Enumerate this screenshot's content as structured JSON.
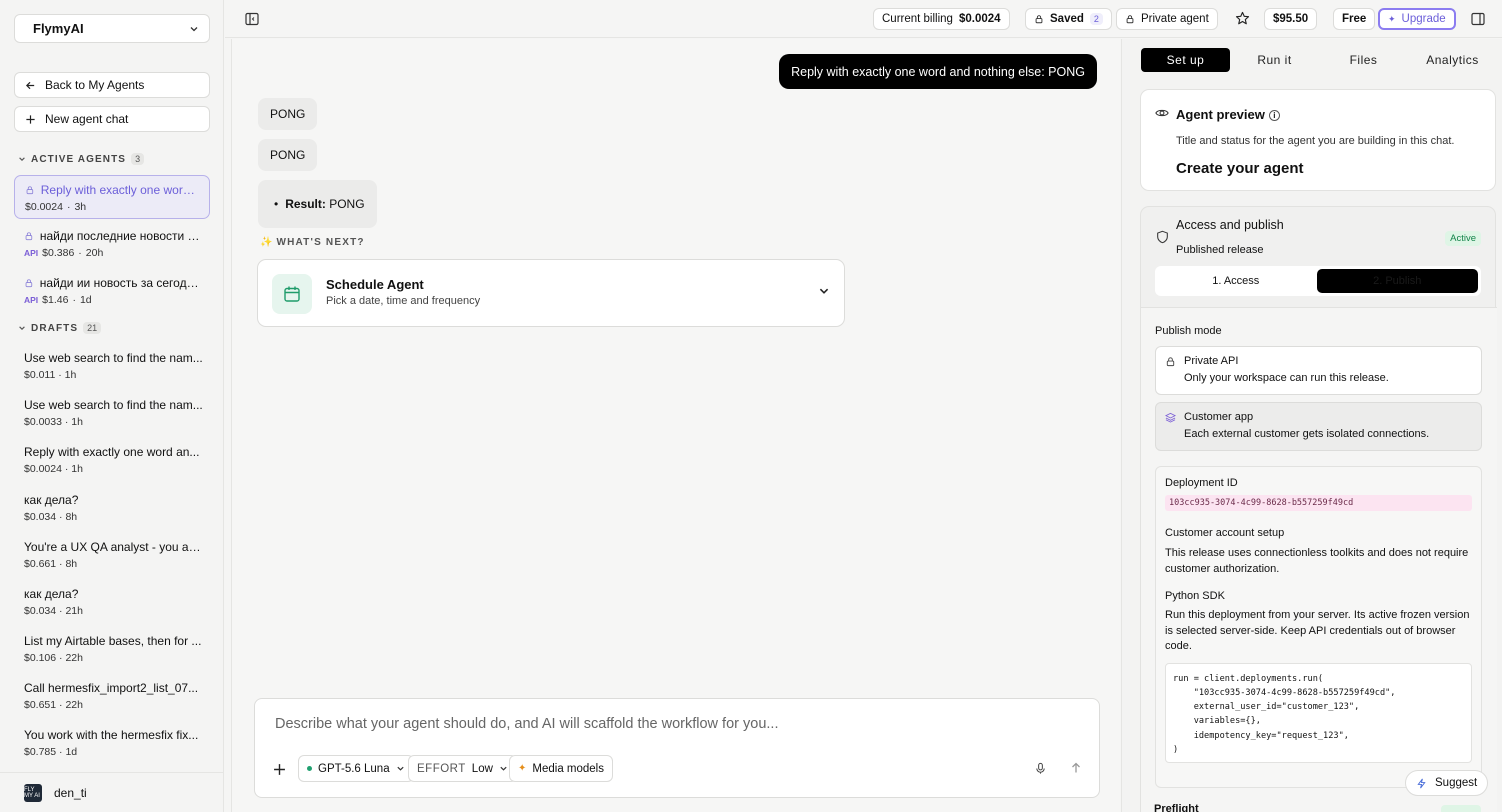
{
  "sidebar": {
    "workspace": "FlymyAI",
    "back_label": "Back to My Agents",
    "new_chat_label": "New agent chat",
    "active_heading": "ACTIVE AGENTS",
    "active_count": "3",
    "active_items": [
      {
        "title": "Reply with exactly one word ...",
        "api": "",
        "cost": "$0.0024",
        "age": "3h"
      },
      {
        "title": "найди последние новости з...",
        "api": "API",
        "cost": "$0.386",
        "age": "20h"
      },
      {
        "title": "найди ии новость за сегодн...",
        "api": "API",
        "cost": "$1.46",
        "age": "1d"
      }
    ],
    "drafts_heading": "DRAFTS",
    "drafts_count": "21",
    "drafts": [
      {
        "title": "Use web search to find the nam...",
        "meta": "$0.011 · 1h"
      },
      {
        "title": "Use web search to find the nam...",
        "meta": "$0.0033 · 1h"
      },
      {
        "title": "Reply with exactly one word an...",
        "meta": "$0.0024 · 1h"
      },
      {
        "title": "как дела?",
        "meta": "$0.034 · 8h"
      },
      {
        "title": "You're a UX QA analyst - you ac...",
        "meta": "$0.661 · 8h"
      },
      {
        "title": "как дела?",
        "meta": "$0.034 · 21h"
      },
      {
        "title": "List my Airtable bases, then for ...",
        "meta": "$0.106 · 22h"
      },
      {
        "title": "Call hermesfix_import2_list_07...",
        "meta": "$0.651 · 22h"
      },
      {
        "title": "You work with the hermesfix fix...",
        "meta": "$0.785 · 1d"
      }
    ],
    "user": "den_ti",
    "avatar_text": "FLY MY AI"
  },
  "topbar": {
    "billing_label": "Current billing",
    "billing_value": "$0.0024",
    "saved_label": "Saved",
    "saved_count": "2",
    "private_label": "Private agent",
    "balance": "$95.50",
    "plan": "Free",
    "upgrade_label": "Upgrade"
  },
  "chat": {
    "user_message": "Reply with exactly one word and nothing else: PONG",
    "bot_replies": [
      "PONG",
      "PONG"
    ],
    "result_label": "Result:",
    "result_value": "PONG",
    "whats_next": "WHAT'S NEXT?",
    "schedule_title": "Schedule Agent",
    "schedule_sub": "Pick a date, time and frequency",
    "composer_placeholder": "Describe what your agent should do, and AI will scaffold the workflow for you...",
    "model": "GPT-5.6 Luna",
    "effort_label": "EFFORT",
    "effort_value": "Low",
    "media_label": "Media models"
  },
  "panel": {
    "tabs": [
      "Set up",
      "Run it",
      "Files",
      "Analytics"
    ],
    "preview_title": "Agent preview",
    "preview_desc": "Title and status for the agent you are building in this chat.",
    "preview_name": "Create your agent",
    "access_title": "Access and publish",
    "access_sub": "Published release",
    "access_status": "Active",
    "step1": "1. Access",
    "step2": "2. Publish",
    "publish_mode": "Publish mode",
    "private_api_title": "Private API",
    "private_api_desc": "Only your workspace can run this release.",
    "customer_app_title": "Customer app",
    "customer_app_desc": "Each external customer gets isolated connections.",
    "deployment_id_label": "Deployment ID",
    "deployment_id": "103cc935-3074-4c99-8628-b557259f49cd",
    "account_setup_label": "Customer account setup",
    "account_setup_desc": "This release uses connectionless toolkits and does not require customer authorization.",
    "sdk_label": "Python SDK",
    "sdk_desc": "Run this deployment from your server. Its active frozen version is selected server-side. Keep API credentials out of browser code.",
    "code": "run = client.deployments.run(\n    \"103cc935-3074-4c99-8628-b557259f49cd\",\n    external_user_id=\"customer_123\",\n    variables={},\n    idempotency_key=\"request_123\",\n)",
    "suggest_label": "Suggest",
    "preflight_label": "Preflight"
  },
  "colors": {
    "accent": "#6c5fd9",
    "active_green": "#14844a",
    "user_bubble": "#000000"
  }
}
